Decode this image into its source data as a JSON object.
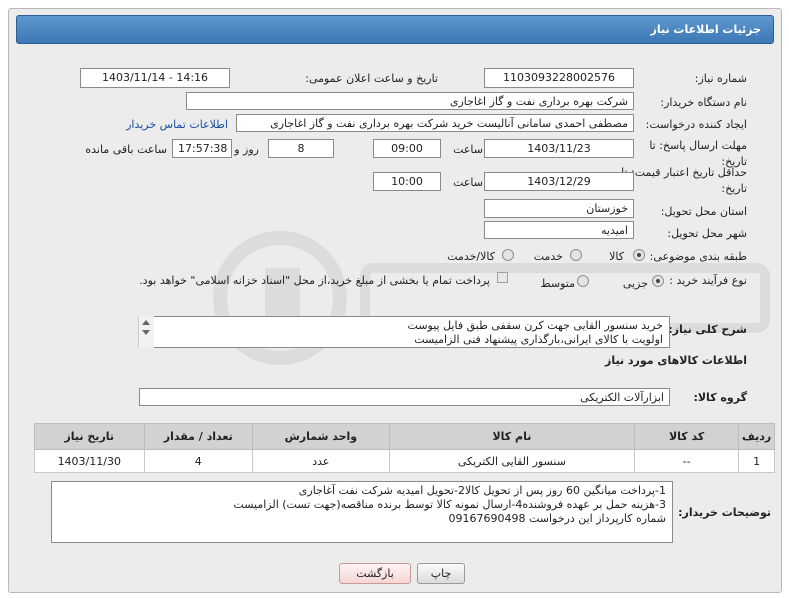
{
  "header": {
    "title": "جزئیات اطلاعات نیاز"
  },
  "fields": {
    "need_number_label": "شماره نیاز:",
    "need_number": "1103093228002576",
    "announce_label": "تاریخ و ساعت اعلان عمومی:",
    "announce_value": "1403/11/14 - 14:16",
    "buyer_org_label": "نام دستگاه خریدار:",
    "buyer_org": "شرکت بهره برداری نفت و گاز اغاجاری",
    "creator_label": "ایجاد کننده درخواست:",
    "creator": "مصطفی احمدی سامانی آنالیست خرید شرکت بهره برداری نفت و گاز اغاجاری",
    "contact_link": "اطلاعات تماس خریدار",
    "reply_deadline_label_1": "مهلت ارسال پاسخ: تا",
    "reply_deadline_label_2": "تاریخ:",
    "reply_date": "1403/11/23",
    "time_label": "ساعت",
    "reply_time": "09:00",
    "days_value": "8",
    "days_label": "روز و",
    "remaining_time": "17:57:38",
    "remaining_label": "ساعت باقی مانده",
    "price_validity_label_1": "حداقل تاریخ اعتبار قیمت: تا",
    "price_validity_label_2": "تاریخ:",
    "price_date": "1403/12/29",
    "price_time": "10:00",
    "province_label": "استان محل تحویل:",
    "province": "خوزستان",
    "city_label": "شهر محل تحویل:",
    "city": "امیدیه",
    "category_label": "طبقه بندی موضوعی:",
    "category_options": [
      "کالا",
      "خدمت",
      "کالا/خدمت"
    ],
    "purchase_type_label": "نوع فرآیند خرید :",
    "purchase_options": [
      "جزیی",
      "متوسط"
    ],
    "payment_note": "پرداخت تمام یا بخشی از مبلغ خرید،از محل \"اسناد خزانه اسلامی\" خواهد بود."
  },
  "description": {
    "label": "شرح کلی نیاز:",
    "lines": [
      "خرید سنسور القایی جهت کرن سقفی طبق فایل پیوست",
      "اولویت با کالای ایرانی،بارگذاری پیشنهاد فنی الزامیست"
    ]
  },
  "goods_section": {
    "title": "اطلاعات کالاهای مورد نیاز",
    "group_label": "گروه کالا:",
    "group_value": "ابزارآلات الکتریکی"
  },
  "table": {
    "headers": [
      "ردیف",
      "کد کالا",
      "نام کالا",
      "واحد شمارش",
      "تعداد / مقدار",
      "تاریخ نیاز"
    ],
    "rows": [
      [
        "1",
        "--",
        "سنسور القایی الکتریکی",
        "عدد",
        "4",
        "1403/11/30"
      ]
    ]
  },
  "buyer_notes": {
    "label": "توضیحات خریدار:",
    "lines": [
      "1-پرداخت میانگین 60 روز پس از تحویل کالا2-تحویل امیدیه شرکت نفت آغاجاری",
      "3-هزینه حمل بر عهده فروشنده4-ارسال نمونه کالا توسط برنده مناقصه(جهت تست) الزامیست",
      "شماره کارپرداز این درخواست 09167690498"
    ]
  },
  "buttons": {
    "print": "چاپ",
    "back": "بازگشت"
  },
  "colors": {
    "title_bar": "#3c78b5",
    "link": "#1a4fa3"
  }
}
